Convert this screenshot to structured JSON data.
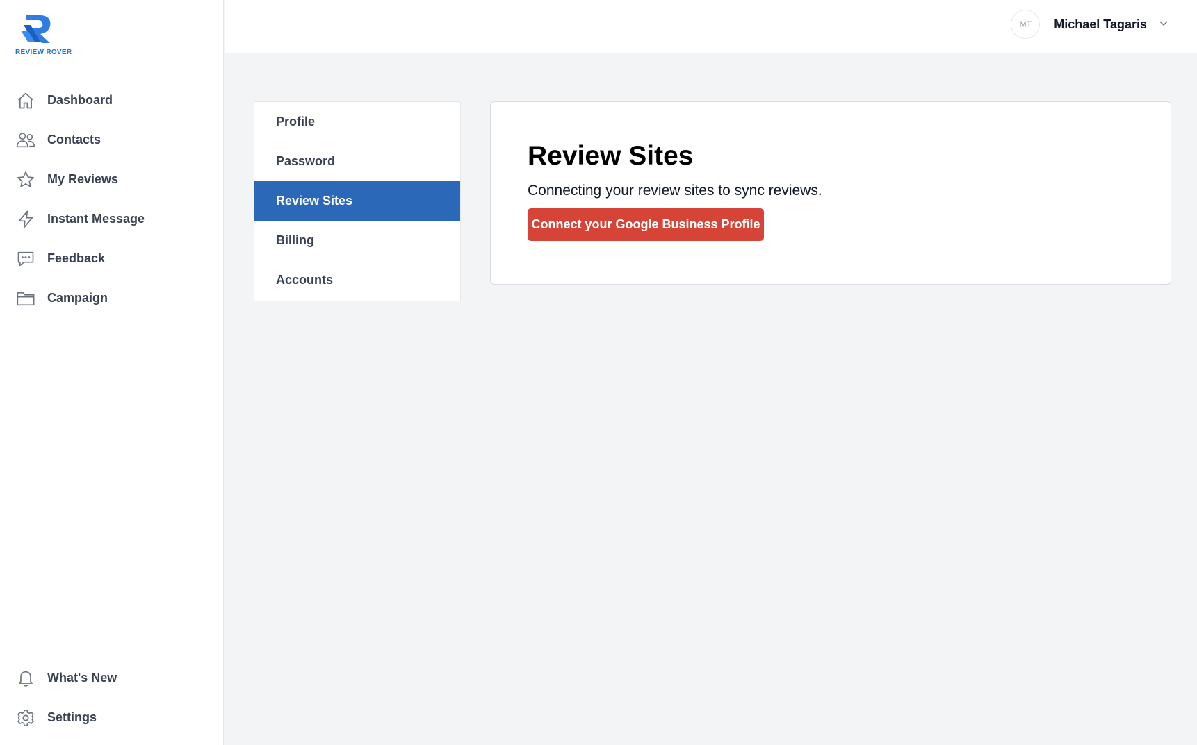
{
  "brand": {
    "name": "REVIEW ROVER",
    "color": "#1d6fd9"
  },
  "sidebar": {
    "items": [
      {
        "label": "Dashboard",
        "icon": "home-icon"
      },
      {
        "label": "Contacts",
        "icon": "users-icon"
      },
      {
        "label": "My Reviews",
        "icon": "star-icon"
      },
      {
        "label": "Instant Message",
        "icon": "lightning-icon"
      },
      {
        "label": "Feedback",
        "icon": "chat-icon"
      },
      {
        "label": "Campaign",
        "icon": "folder-icon"
      }
    ],
    "bottom_items": [
      {
        "label": "What's New",
        "icon": "bell-icon"
      },
      {
        "label": "Settings",
        "icon": "gear-icon"
      }
    ]
  },
  "header": {
    "user": {
      "initials": "MT",
      "name": "Michael Tagaris"
    }
  },
  "settings": {
    "tabs": [
      {
        "label": "Profile"
      },
      {
        "label": "Password"
      },
      {
        "label": "Review Sites",
        "active": true
      },
      {
        "label": "Billing"
      },
      {
        "label": "Accounts"
      }
    ]
  },
  "main": {
    "title": "Review Sites",
    "description": "Connecting your review sites to sync reviews.",
    "connect_button": "Connect your Google Business Profile"
  },
  "colors": {
    "active_tab": "#2b69b8",
    "google_button": "#d64438",
    "background": "#f3f4f6"
  }
}
